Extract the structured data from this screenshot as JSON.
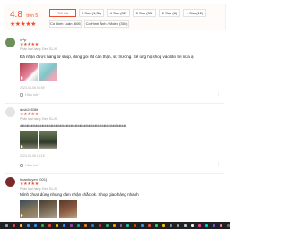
{
  "summary": {
    "score": "4.8",
    "out_of": "trên 5",
    "stars": "★★★★★",
    "filters": [
      {
        "label": "Tất Cả",
        "active": true
      },
      {
        "label": "5 Sao (1,3k)",
        "active": false
      },
      {
        "label": "4 Sao (82)",
        "active": false
      },
      {
        "label": "3 Sao (33)",
        "active": false
      },
      {
        "label": "2 Sao (8)",
        "active": false
      },
      {
        "label": "1 Sao (12)",
        "active": false
      },
      {
        "label": "Có Bình Luận (606)",
        "active": false
      },
      {
        "label": "Có Hình Ảnh / Video (354)",
        "active": false
      }
    ]
  },
  "reviews": [
    {
      "name": "v**p",
      "stars": "★★★★★",
      "meta": "Phân loại hàng: Đen S1-Xl",
      "text": "Đã nhận được hàng từ shop, đóng gói rất cẩn thận, sử trường. Sẽ ủng hộ shop vào lần tới nữa ạ",
      "time": "2023-06-06 06:59",
      "likes": "Hữu ích?",
      "more": "⋮"
    },
    {
      "name": "dvvk2x536t",
      "stars": "★★★★★",
      "meta": "Phân loại hàng: Đen S1-Xl",
      "text": "dddddddddddddddddddddddddddddddddddddddddddddddddddddddddddddddddddddd",
      "time": "2023-06-06 14:15",
      "likes": "Hữu ích?",
      "more": "⋮"
    },
    {
      "name": "hoanhuyen (001)",
      "stars": "★★★★★",
      "meta": "Phân loại hàng: Đen S1-Xl",
      "text": "Mình chưa dùng nhưng cảm nhận chắc ok. Shop giao hàng nhanh",
      "time": "",
      "likes": "",
      "more": ""
    }
  ],
  "colors": {
    "accent": "#ee4d2d",
    "taskbar": "#1f2023"
  },
  "taskbar_icons": [
    "search-icon",
    "chrome-icon",
    "folder-icon",
    "store-icon",
    "mail-icon",
    "app-icon",
    "app-icon",
    "app-icon",
    "app-icon",
    "app-icon",
    "app-icon",
    "app-icon",
    "app-icon",
    "app-icon",
    "app-icon",
    "app-icon",
    "app-icon",
    "app-icon",
    "app-icon",
    "app-icon",
    "app-icon",
    "app-icon",
    "app-icon",
    "app-icon",
    "app-icon",
    "app-icon",
    "app-icon",
    "app-icon",
    "app-icon",
    "app-icon",
    "app-icon",
    "app-icon"
  ]
}
